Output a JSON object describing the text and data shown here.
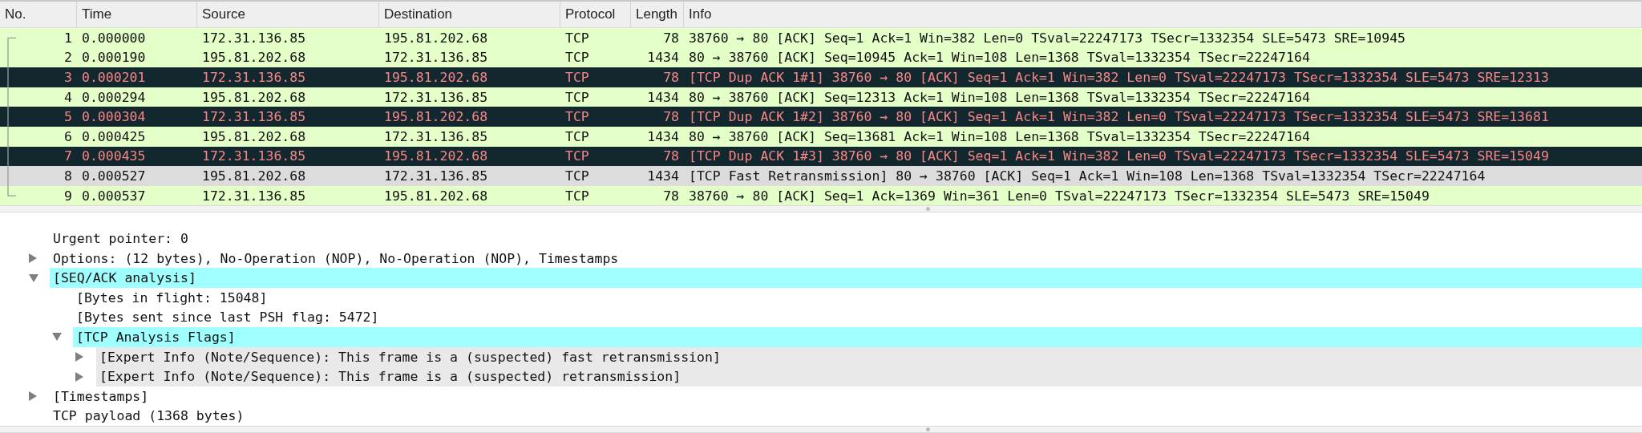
{
  "packet_list": {
    "columns": [
      "No.",
      "Time",
      "Source",
      "Destination",
      "Protocol",
      "Length",
      "Info"
    ],
    "rows": [
      {
        "no": "1",
        "time": "0.000000",
        "source": "172.31.136.85",
        "destination": "195.81.202.68",
        "protocol": "TCP",
        "length": "78",
        "info": "38760 → 80 [ACK] Seq=1 Ack=1 Win=382 Len=0 TSval=22247173 TSecr=1332354 SLE=5473 SRE=10945",
        "kind": "tcp",
        "selected": false
      },
      {
        "no": "2",
        "time": "0.000190",
        "source": "195.81.202.68",
        "destination": "172.31.136.85",
        "protocol": "TCP",
        "length": "1434",
        "info": "80 → 38760 [ACK] Seq=10945 Ack=1 Win=108 Len=1368 TSval=1332354 TSecr=22247164",
        "kind": "tcp",
        "selected": false
      },
      {
        "no": "3",
        "time": "0.000201",
        "source": "172.31.136.85",
        "destination": "195.81.202.68",
        "protocol": "TCP",
        "length": "78",
        "info": "[TCP Dup ACK 1#1] 38760 → 80 [ACK] Seq=1 Ack=1 Win=382 Len=0 TSval=22247173 TSecr=1332354 SLE=5473 SRE=12313",
        "kind": "bad_tcp",
        "selected": false
      },
      {
        "no": "4",
        "time": "0.000294",
        "source": "195.81.202.68",
        "destination": "172.31.136.85",
        "protocol": "TCP",
        "length": "1434",
        "info": "80 → 38760 [ACK] Seq=12313 Ack=1 Win=108 Len=1368 TSval=1332354 TSecr=22247164",
        "kind": "tcp",
        "selected": false
      },
      {
        "no": "5",
        "time": "0.000304",
        "source": "172.31.136.85",
        "destination": "195.81.202.68",
        "protocol": "TCP",
        "length": "78",
        "info": "[TCP Dup ACK 1#2] 38760 → 80 [ACK] Seq=1 Ack=1 Win=382 Len=0 TSval=22247173 TSecr=1332354 SLE=5473 SRE=13681",
        "kind": "bad_tcp",
        "selected": false
      },
      {
        "no": "6",
        "time": "0.000425",
        "source": "195.81.202.68",
        "destination": "172.31.136.85",
        "protocol": "TCP",
        "length": "1434",
        "info": "80 → 38760 [ACK] Seq=13681 Ack=1 Win=108 Len=1368 TSval=1332354 TSecr=22247164",
        "kind": "tcp",
        "selected": false
      },
      {
        "no": "7",
        "time": "0.000435",
        "source": "172.31.136.85",
        "destination": "195.81.202.68",
        "protocol": "TCP",
        "length": "78",
        "info": "[TCP Dup ACK 1#3] 38760 → 80 [ACK] Seq=1 Ack=1 Win=382 Len=0 TSval=22247173 TSecr=1332354 SLE=5473 SRE=15049",
        "kind": "bad_tcp",
        "selected": false
      },
      {
        "no": "8",
        "time": "0.000527",
        "source": "195.81.202.68",
        "destination": "172.31.136.85",
        "protocol": "TCP",
        "length": "1434",
        "info": "[TCP Fast Retransmission] 80 → 38760 [ACK] Seq=1 Ack=1 Win=108 Len=1368 TSval=1332354 TSecr=22247164",
        "kind": "tcp",
        "selected": true
      },
      {
        "no": "9",
        "time": "0.000537",
        "source": "172.31.136.85",
        "destination": "195.81.202.68",
        "protocol": "TCP",
        "length": "78",
        "info": "38760 → 80 [ACK] Seq=1 Ack=1369 Win=361 Len=0 TSval=22247173 TSecr=1332354 SLE=5473 SRE=15049",
        "kind": "tcp",
        "selected": false
      }
    ]
  },
  "packet_details": [
    {
      "label": "Urgent pointer: 0",
      "kind": "plain"
    },
    {
      "label": "Options: (12 bytes), No-Operation (NOP), No-Operation (NOP), Timestamps",
      "kind": "plain",
      "expanded": false
    },
    {
      "label": "[SEQ/ACK analysis]",
      "kind": "analysis",
      "expanded": true,
      "children": [
        {
          "label": "[Bytes in flight: 15048]",
          "kind": "plain"
        },
        {
          "label": "[Bytes sent since last PSH flag: 5472]",
          "kind": "plain"
        },
        {
          "label": "[TCP Analysis Flags]",
          "kind": "analysis",
          "expanded": true,
          "children": [
            {
              "label": "[Expert Info (Note/Sequence): This frame is a (suspected) fast retransmission]",
              "kind": "expert",
              "expanded": false
            },
            {
              "label": "[Expert Info (Note/Sequence): This frame is a (suspected) retransmission]",
              "kind": "expert",
              "expanded": false
            }
          ]
        }
      ]
    },
    {
      "label": "[Timestamps]",
      "kind": "plain",
      "expanded": false
    },
    {
      "label": "TCP payload (1368 bytes)",
      "kind": "plain"
    }
  ]
}
